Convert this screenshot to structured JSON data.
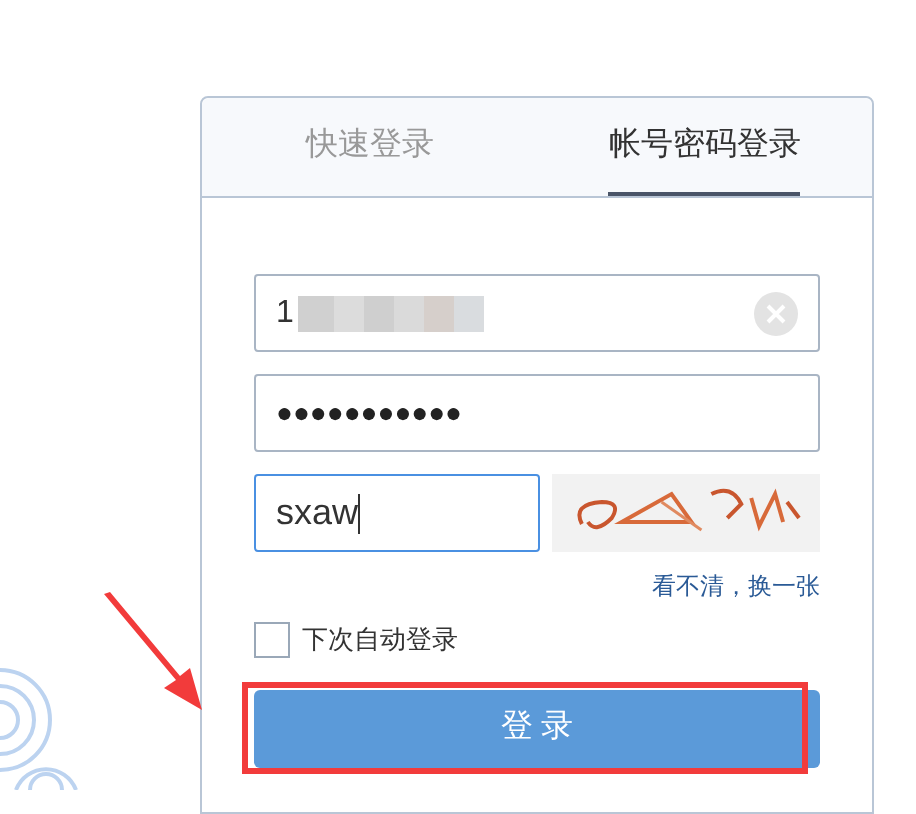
{
  "tabs": [
    {
      "label": "快速登录",
      "selected": false
    },
    {
      "label": "帐号密码登录",
      "selected": true
    }
  ],
  "username": {
    "value": "1"
  },
  "password": {
    "value": "●●●●●●●●●●●"
  },
  "captcha": {
    "value": "sxaw"
  },
  "refresh_link": "看不清，换一张",
  "remember": {
    "label": "下次自动登录",
    "checked": false
  },
  "login_button": "登 录"
}
